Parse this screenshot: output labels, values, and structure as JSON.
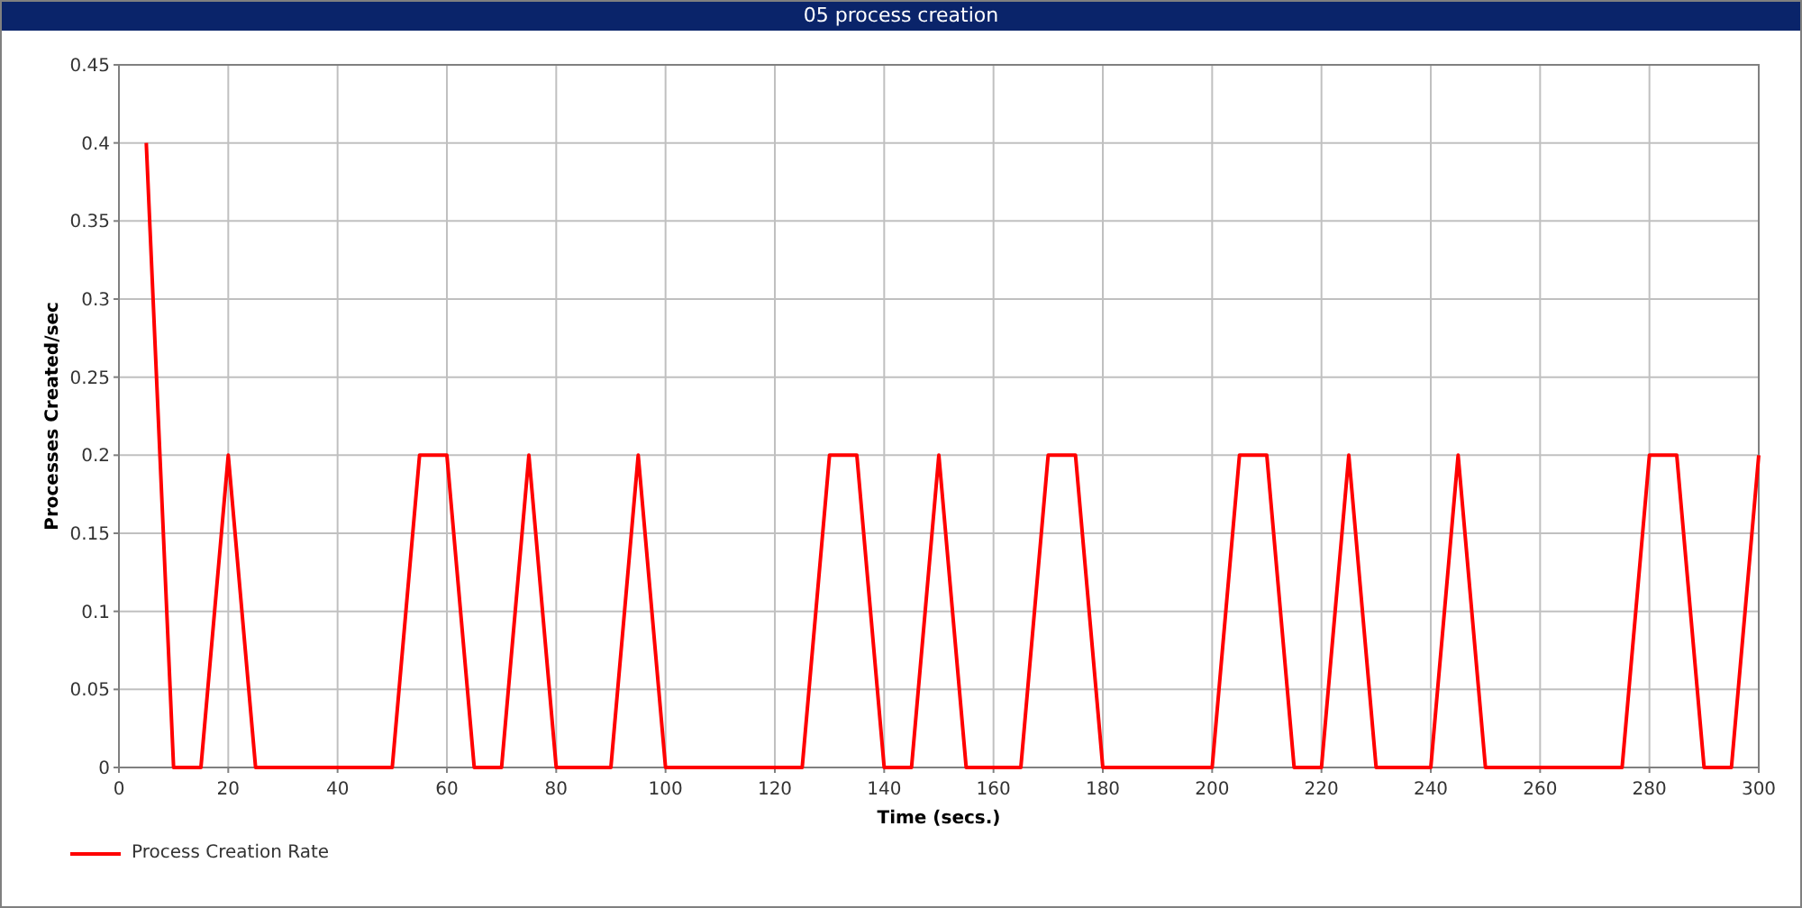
{
  "window": {
    "title": "05 process creation"
  },
  "chart": {
    "chart_data": {
      "type": "line",
      "grid": true,
      "xlabel": "Time (secs.)",
      "ylabel": "Processes Created/sec",
      "xlim": [
        0,
        300
      ],
      "ylim": [
        0,
        0.45
      ],
      "xticks": [
        0,
        20,
        40,
        60,
        80,
        100,
        120,
        140,
        160,
        180,
        200,
        220,
        240,
        260,
        280,
        300
      ],
      "yticks": [
        {
          "value": 0,
          "label": "0"
        },
        {
          "value": 0.05,
          "label": "0.05"
        },
        {
          "value": 0.1,
          "label": "0.1"
        },
        {
          "value": 0.15,
          "label": "0.15"
        },
        {
          "value": 0.2,
          "label": "0.2"
        },
        {
          "value": 0.25,
          "label": "0.25"
        },
        {
          "value": 0.3,
          "label": "0.3"
        },
        {
          "value": 0.35,
          "label": "0.35"
        },
        {
          "value": 0.4,
          "label": "0.4"
        },
        {
          "value": 0.45,
          "label": "0.45"
        }
      ],
      "x": [
        5,
        10,
        15,
        20,
        25,
        30,
        35,
        40,
        45,
        50,
        55,
        60,
        65,
        70,
        75,
        80,
        85,
        90,
        95,
        100,
        105,
        110,
        115,
        120,
        125,
        130,
        135,
        140,
        145,
        150,
        155,
        160,
        165,
        170,
        175,
        180,
        185,
        190,
        195,
        200,
        205,
        210,
        215,
        220,
        225,
        230,
        235,
        240,
        245,
        250,
        255,
        260,
        265,
        270,
        275,
        280,
        285,
        290,
        295,
        300
      ],
      "series": [
        {
          "name": "Process Creation Rate",
          "color": "#ff0000",
          "values": [
            0.4,
            0,
            0,
            0.2,
            0,
            0,
            0,
            0,
            0,
            0,
            0.2,
            0.2,
            0,
            0,
            0.2,
            0,
            0,
            0,
            0.2,
            0,
            0,
            0,
            0,
            0,
            0,
            0.2,
            0.2,
            0,
            0,
            0.2,
            0,
            0,
            0,
            0.2,
            0.2,
            0,
            0,
            0,
            0,
            0,
            0.2,
            0.2,
            0,
            0,
            0.2,
            0,
            0,
            0,
            0.2,
            0,
            0,
            0,
            0,
            0,
            0,
            0.2,
            0.2,
            0,
            0,
            0.2
          ]
        }
      ]
    }
  }
}
